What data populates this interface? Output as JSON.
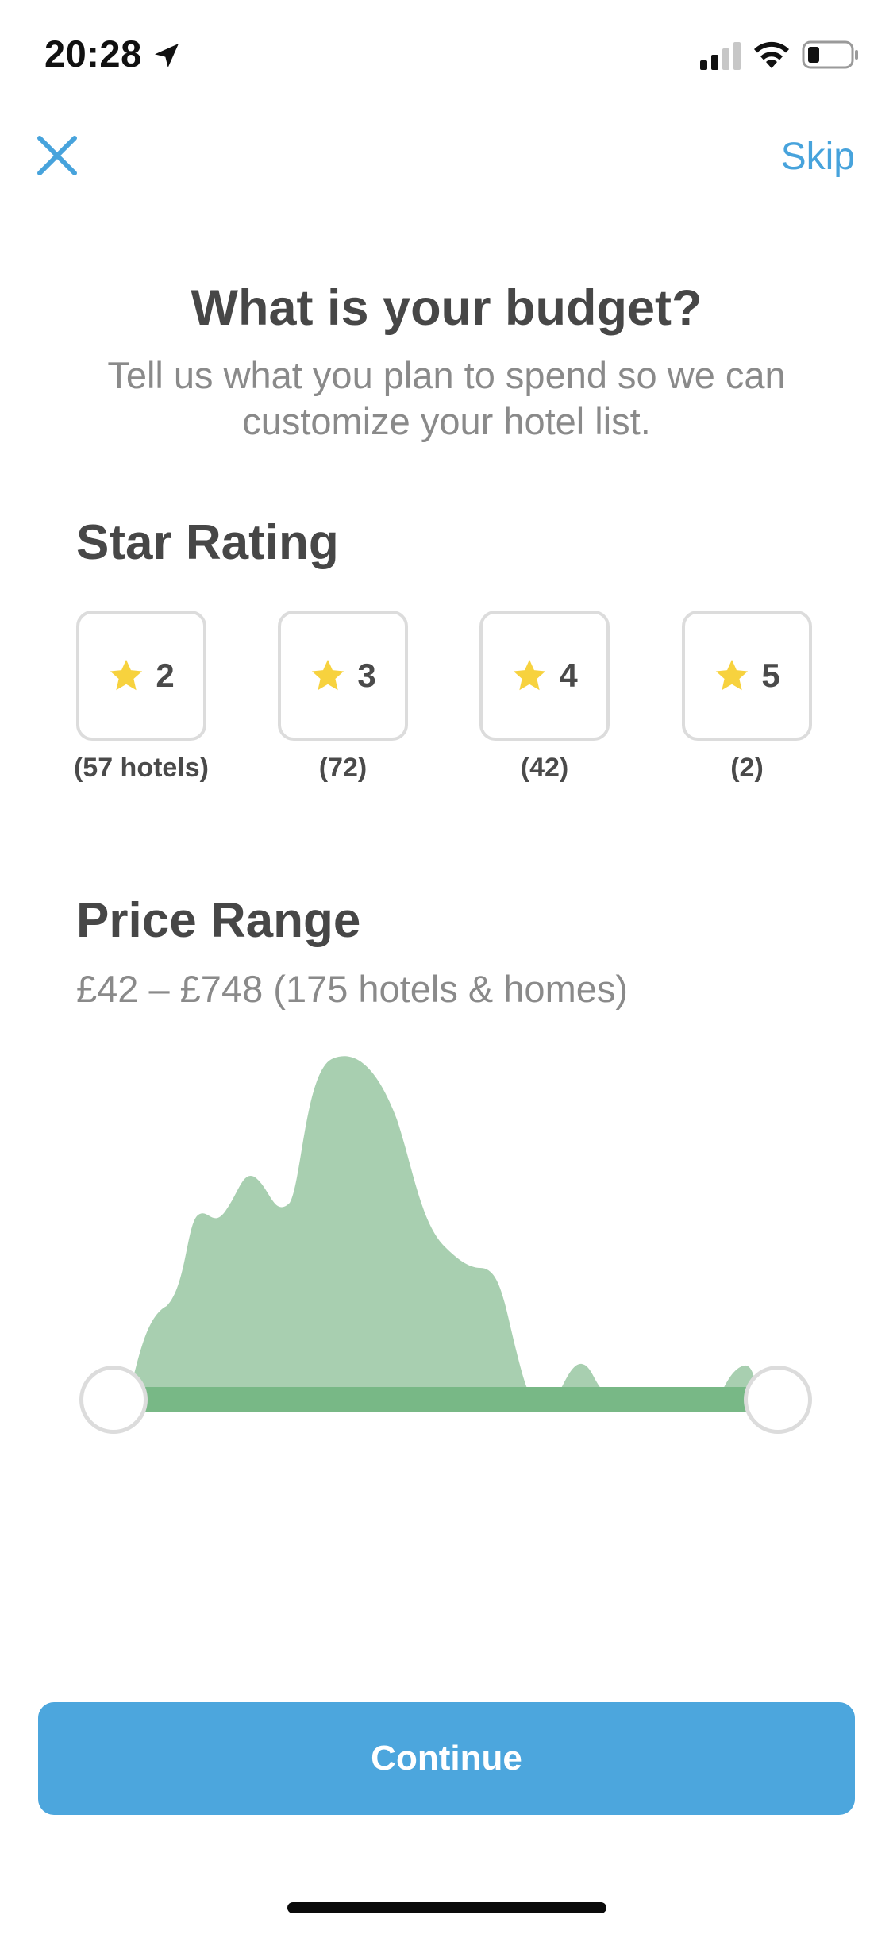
{
  "status_bar": {
    "time": "20:28",
    "location_icon": "location-arrow-icon",
    "signal_icon": "cellular-signal-icon",
    "wifi_icon": "wifi-icon",
    "battery_icon": "battery-icon",
    "battery_level": 0.2,
    "signal_bars_filled": 2,
    "signal_bars_total": 4
  },
  "header": {
    "close_icon": "close-icon",
    "skip_label": "Skip"
  },
  "intro": {
    "title": "What is your budget?",
    "subtitle_line1": "Tell us what you plan to spend so we can",
    "subtitle_line2": "customize your hotel list."
  },
  "star_rating": {
    "title": "Star Rating",
    "options": [
      {
        "stars": "2",
        "count": "(57 hotels)"
      },
      {
        "stars": "3",
        "count": "(72)"
      },
      {
        "stars": "4",
        "count": "(42)"
      },
      {
        "stars": "5",
        "count": "(2)"
      }
    ]
  },
  "price_range": {
    "title": "Price Range",
    "summary": "£42 – £748 (175 hotels & homes)",
    "selected_min_fraction": 0,
    "selected_max_fraction": 1
  },
  "footer": {
    "continue_label": "Continue"
  },
  "colors": {
    "accent_blue": "#4ca6dd",
    "link_blue": "#47a3dc",
    "histogram_fill": "#a8cfb0",
    "track_green": "#78b886",
    "star_yellow": "#f7d23e"
  }
}
